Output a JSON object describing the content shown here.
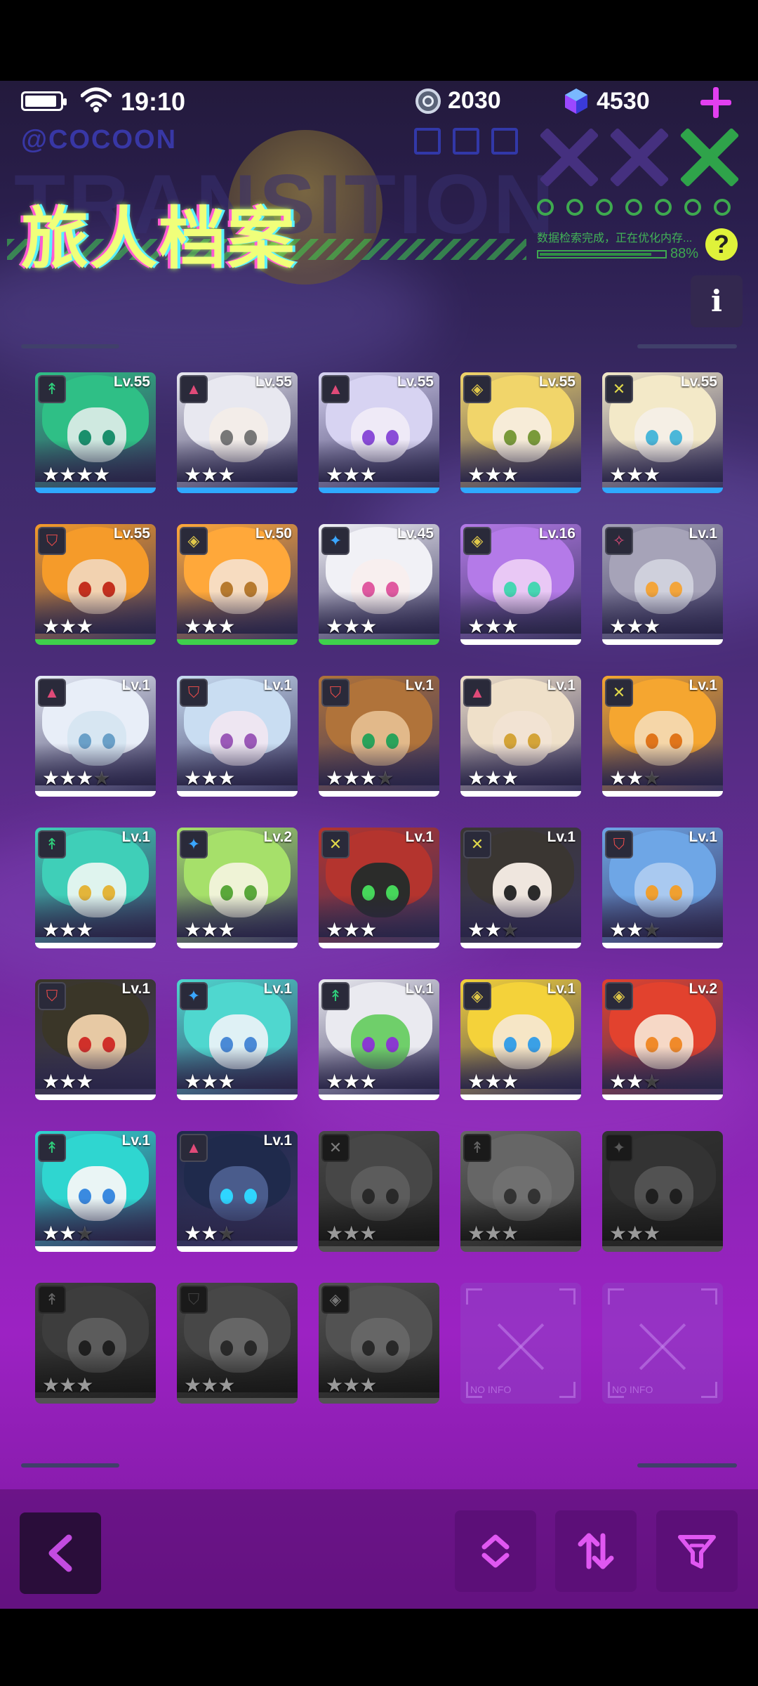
{
  "status_bar": {
    "time": "19:10"
  },
  "currencies": {
    "coins": "2030",
    "gems": "4530"
  },
  "header": {
    "title": "旅人档案",
    "brand": "@COCOON",
    "bg_word": "TRANSITION",
    "loading_text": "数据检索完成，正在优化内存...",
    "loading_progress": 0.88,
    "loading_percent": "88%",
    "help_label": "?",
    "info_label": "i"
  },
  "grid": {
    "cards": [
      {
        "level": "Lv.55",
        "stars": 4,
        "max_stars": 4,
        "role": "archer-icon",
        "hair": "#2fbf86",
        "face": "#cfe9e0",
        "eye": "#1a8f6c",
        "underline": "#2fa9ff",
        "locked": false
      },
      {
        "level": "Lv.55",
        "stars": 3,
        "max_stars": 3,
        "role": "mage-icon",
        "hair": "#e8e8f0",
        "face": "#f3ede9",
        "eye": "#777",
        "underline": "#2fa9ff",
        "locked": false
      },
      {
        "level": "Lv.55",
        "stars": 3,
        "max_stars": 3,
        "role": "mage-icon",
        "hair": "#d7d3f2",
        "face": "#efeaf7",
        "eye": "#8a4cd8",
        "underline": "#2fa9ff",
        "locked": false
      },
      {
        "level": "Lv.55",
        "stars": 3,
        "max_stars": 3,
        "role": "support-icon",
        "hair": "#f1d56a",
        "face": "#f7ecd8",
        "eye": "#7a9a3a",
        "underline": "#2fa9ff",
        "locked": false
      },
      {
        "level": "Lv.55",
        "stars": 3,
        "max_stars": 3,
        "role": "warrior-icon",
        "hair": "#f3e9c8",
        "face": "#f5efe5",
        "eye": "#4ab7d9",
        "underline": "#2fa9ff",
        "locked": false
      },
      {
        "level": "Lv.55",
        "stars": 3,
        "max_stars": 3,
        "role": "tank-icon",
        "hair": "#f59b2a",
        "face": "#f2d2b0",
        "eye": "#c4301e",
        "underline": "#3fd04c",
        "locked": false
      },
      {
        "level": "Lv.50",
        "stars": 3,
        "max_stars": 3,
        "role": "support-icon",
        "hair": "#ffa83a",
        "face": "#f7dcc0",
        "eye": "#b77a2e",
        "underline": "#3fd04c",
        "locked": false
      },
      {
        "level": "Lv.45",
        "stars": 3,
        "max_stars": 3,
        "role": "ranger-icon",
        "hair": "#f1f1f6",
        "face": "#f8efef",
        "eye": "#e05aa0",
        "underline": "#3fd04c",
        "locked": false
      },
      {
        "level": "Lv.16",
        "stars": 3,
        "max_stars": 3,
        "role": "support-icon",
        "hair": "#b47ae8",
        "face": "#e9c8f5",
        "eye": "#47d6b3",
        "underline": "#ffffff",
        "locked": false
      },
      {
        "level": "Lv.1",
        "stars": 3,
        "max_stars": 3,
        "role": "assassin-icon",
        "hair": "#a6a3b8",
        "face": "#cfd0dc",
        "eye": "#f3a53b",
        "underline": "#ffffff",
        "locked": false
      },
      {
        "level": "Lv.1",
        "stars": 3,
        "max_stars": 4,
        "role": "mage-icon",
        "hair": "#e8eef8",
        "face": "#d7e6f2",
        "eye": "#6aa0c8",
        "underline": "#ffffff",
        "locked": false
      },
      {
        "level": "Lv.1",
        "stars": 3,
        "max_stars": 3,
        "role": "tank-icon",
        "hair": "#c9ddf2",
        "face": "#eee6f2",
        "eye": "#9b59b8",
        "underline": "#ffffff",
        "locked": false
      },
      {
        "level": "Lv.1",
        "stars": 3,
        "max_stars": 4,
        "role": "tank-icon",
        "hair": "#b0733a",
        "face": "#e2b98a",
        "eye": "#2aa35a",
        "underline": "#ffffff",
        "locked": false
      },
      {
        "level": "Lv.1",
        "stars": 3,
        "max_stars": 3,
        "role": "mage-icon",
        "hair": "#efe0c9",
        "face": "#f2e3d3",
        "eye": "#d4a438",
        "underline": "#ffffff",
        "locked": false
      },
      {
        "level": "Lv.1",
        "stars": 2,
        "max_stars": 3,
        "role": "warrior-icon",
        "hair": "#f5a630",
        "face": "#f5d6a8",
        "eye": "#e0751a",
        "underline": "#ffffff",
        "locked": false
      },
      {
        "level": "Lv.1",
        "stars": 3,
        "max_stars": 3,
        "role": "archer-icon",
        "hair": "#3fcfb8",
        "face": "#dff4ee",
        "eye": "#e3b53a",
        "underline": "#ffffff",
        "locked": false
      },
      {
        "level": "Lv.2",
        "stars": 3,
        "max_stars": 3,
        "role": "ranger-icon",
        "hair": "#a6e06a",
        "face": "#eff3d6",
        "eye": "#5aa83a",
        "underline": "#ffffff",
        "locked": false
      },
      {
        "level": "Lv.1",
        "stars": 3,
        "max_stars": 3,
        "role": "warrior-icon",
        "hair": "#b4342e",
        "face": "#2b2c2a",
        "eye": "#46d65a",
        "underline": "#ffffff",
        "locked": false
      },
      {
        "level": "Lv.1",
        "stars": 2,
        "max_stars": 3,
        "role": "warrior-icon",
        "hair": "#3a3632",
        "face": "#efe6de",
        "eye": "#2b2b2b",
        "underline": "#ffffff",
        "locked": false
      },
      {
        "level": "Lv.1",
        "stars": 2,
        "max_stars": 3,
        "role": "tank-icon",
        "hair": "#6ea6e6",
        "face": "#a9c9f0",
        "eye": "#f0a030",
        "underline": "#ffffff",
        "locked": false
      },
      {
        "level": "Lv.1",
        "stars": 3,
        "max_stars": 3,
        "role": "tank-icon",
        "hair": "#3a3628",
        "face": "#e7c9a4",
        "eye": "#d0302a",
        "underline": "#ffffff",
        "locked": false
      },
      {
        "level": "Lv.1",
        "stars": 3,
        "max_stars": 3,
        "role": "ranger-icon",
        "hair": "#4fd7cf",
        "face": "#dff1f5",
        "eye": "#4a8ad6",
        "underline": "#ffffff",
        "locked": false
      },
      {
        "level": "Lv.1",
        "stars": 3,
        "max_stars": 3,
        "role": "archer-icon",
        "hair": "#eaeaf0",
        "face": "#6fcf6a",
        "eye": "#8a3ad0",
        "underline": "#ffffff",
        "locked": false
      },
      {
        "level": "Lv.1",
        "stars": 3,
        "max_stars": 3,
        "role": "support-icon",
        "hair": "#f4d23a",
        "face": "#f6e6c6",
        "eye": "#3aa0e6",
        "underline": "#ffffff",
        "locked": false
      },
      {
        "level": "Lv.2",
        "stars": 2,
        "max_stars": 3,
        "role": "support-icon",
        "hair": "#e2422e",
        "face": "#f6d8c6",
        "eye": "#f08a2a",
        "underline": "#ffffff",
        "locked": false
      },
      {
        "level": "Lv.1",
        "stars": 2,
        "max_stars": 3,
        "role": "archer-icon",
        "hair": "#2fd6d0",
        "face": "#eaf5f5",
        "eye": "#3a8ae0",
        "underline": "#ffffff",
        "locked": false
      },
      {
        "level": "Lv.1",
        "stars": 2,
        "max_stars": 3,
        "role": "mage-icon",
        "hair": "#1f2a4c",
        "face": "#4a5c8c",
        "eye": "#2fd6ff",
        "underline": "#ffffff",
        "locked": false
      },
      {
        "level": "",
        "stars": 3,
        "max_stars": 3,
        "role": "warrior-icon",
        "hair": "#777",
        "face": "#999",
        "eye": "#444",
        "underline": "#8a8a8a",
        "locked": true
      },
      {
        "level": "",
        "stars": 3,
        "max_stars": 3,
        "role": "archer-icon",
        "hair": "#aaa",
        "face": "#bbb",
        "eye": "#555",
        "underline": "#8a8a8a",
        "locked": true
      },
      {
        "level": "",
        "stars": 3,
        "max_stars": 3,
        "role": "ranger-icon",
        "hair": "#555",
        "face": "#888",
        "eye": "#333",
        "underline": "#8a8a8a",
        "locked": true
      },
      {
        "level": "",
        "stars": 3,
        "max_stars": 3,
        "role": "archer-icon",
        "hair": "#666",
        "face": "#999",
        "eye": "#333",
        "underline": "#8a8a8a",
        "locked": true
      },
      {
        "level": "",
        "stars": 3,
        "max_stars": 3,
        "role": "tank-icon",
        "hair": "#777",
        "face": "#aaa",
        "eye": "#444",
        "underline": "#8a8a8a",
        "locked": true
      },
      {
        "level": "",
        "stars": 3,
        "max_stars": 3,
        "role": "support-icon",
        "hair": "#888",
        "face": "#aaa",
        "eye": "#444",
        "underline": "#8a8a8a",
        "locked": true
      },
      {
        "empty": true,
        "label": "NO INFO"
      },
      {
        "empty": true,
        "label": "NO INFO"
      }
    ]
  },
  "toolbar": {
    "back_icon": "chevron-left-icon",
    "sort_order_icon": "sort-order-icon",
    "sort_swap_icon": "sort-swap-icon",
    "filter_icon": "filter-icon"
  },
  "colors": {
    "accent": "#e23ff0",
    "title_glow": "#f0ff7a",
    "lit_x": "#2fa34a"
  }
}
